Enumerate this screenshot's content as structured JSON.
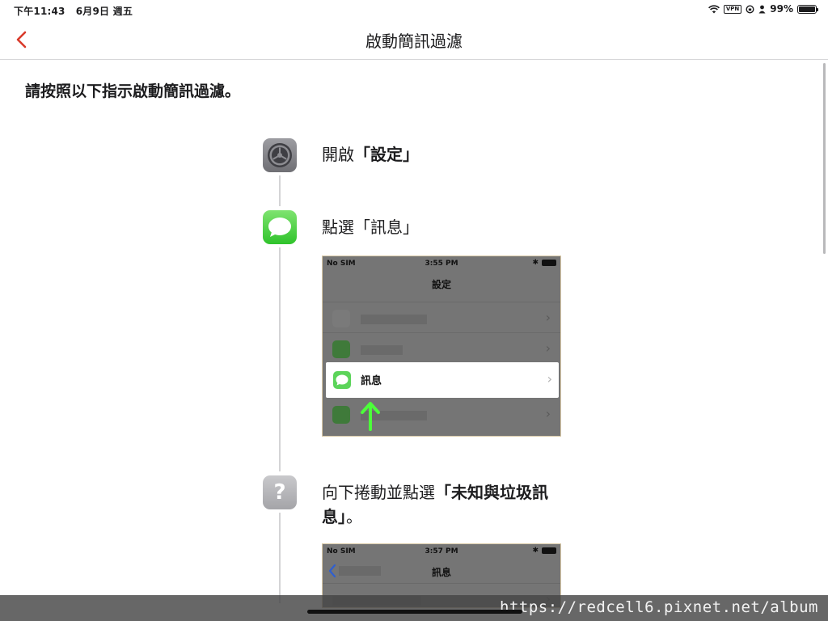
{
  "status_bar": {
    "time": "下午11:43",
    "date": "6月9日 週五",
    "vpn": "VPN",
    "battery": "99%",
    "battery_level": 0.99
  },
  "nav": {
    "title": "啟動簡訊過濾",
    "accent_color": "#d93a2b"
  },
  "intro": "請按照以下指示啟動簡訊過濾。",
  "steps": [
    {
      "icon": "settings-app-icon",
      "prefix": "開啟",
      "bold": "「設定」",
      "suffix": ""
    },
    {
      "icon": "messages-app-icon",
      "prefix": "點選「訊息」",
      "bold": "",
      "suffix": ""
    },
    {
      "icon": "question-mark-icon",
      "icon_glyph": "?",
      "prefix": "向下捲動並點選",
      "bold": "「未知與垃圾訊息」",
      "suffix": "。"
    }
  ],
  "screenshot1": {
    "carrier": "No SIM",
    "time": "3:55 PM",
    "title": "設定",
    "highlight_label": "訊息",
    "arrow_color": "#4cff3a"
  },
  "screenshot2": {
    "carrier": "No SIM",
    "time": "3:57 PM",
    "title": "訊息"
  },
  "watermark": "https://redcell6.pixnet.net/album"
}
